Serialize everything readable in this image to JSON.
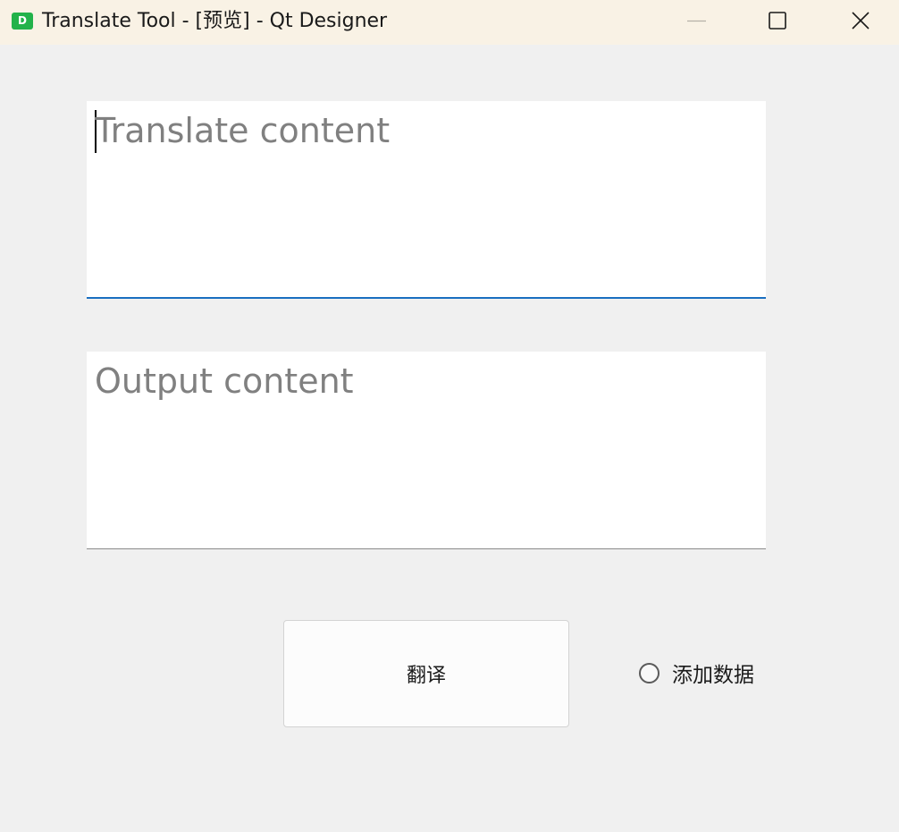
{
  "window": {
    "title": "Translate Tool - [预览] - Qt Designer",
    "app_icon_letter": "D",
    "controls": {
      "minimize_icon": "minimize-icon",
      "maximize_icon": "maximize-icon",
      "close_icon": "close-icon"
    }
  },
  "main": {
    "source_input": {
      "placeholder": "Translate content",
      "value": ""
    },
    "output_box": {
      "placeholder": "Output content",
      "value": ""
    },
    "translate_button_label": "翻译",
    "add_data_radio": {
      "label": "添加数据",
      "checked": false
    }
  },
  "colors": {
    "titlebar_bg": "#f9f2e5",
    "window_bg": "#f0f0f0",
    "focus_accent": "#1a6fc0",
    "placeholder_text": "#808080"
  }
}
